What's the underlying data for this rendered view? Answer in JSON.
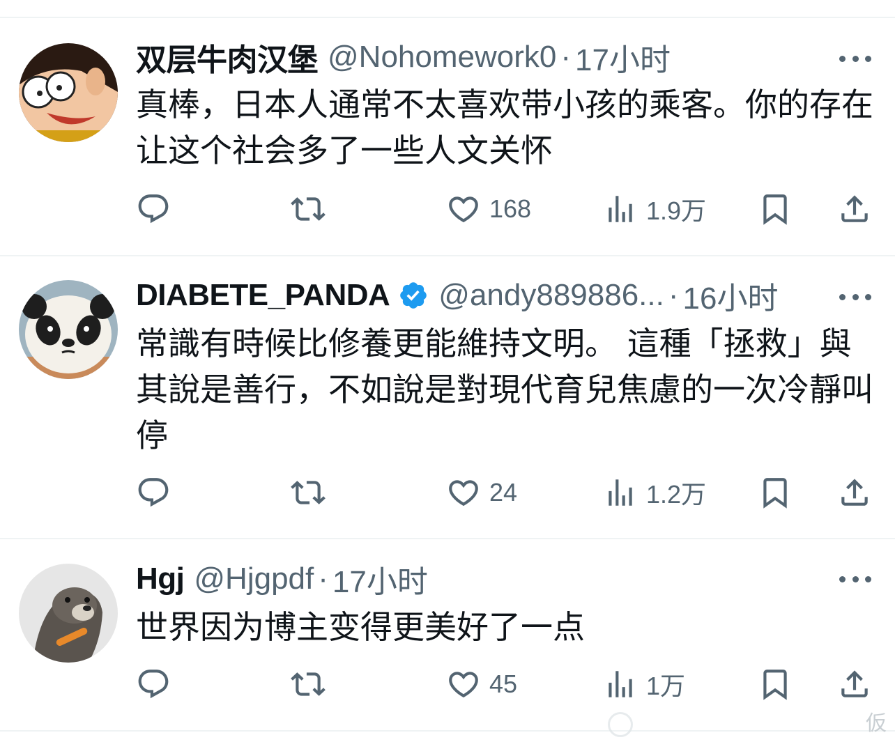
{
  "tweets": [
    {
      "name": "双层牛肉汉堡",
      "handle": "@Nohomework0",
      "separator": "·",
      "time": "17小时",
      "verified": false,
      "text": "真棒，日本人通常不太喜欢带小孩的乘客。你的存在让这个社会多了一些人文关怀",
      "likes": "168",
      "views": "1.9万",
      "avatar_icon": "cartoon-avatar"
    },
    {
      "name": "DIABETE_PANDA",
      "handle": "@andy889886...",
      "separator": "·",
      "time": "16小时",
      "verified": true,
      "text": "常識有時候比修養更能維持文明。 這種「拯救」與其說是善行，不如說是對現代育兒焦慮的一次冷靜叫停",
      "likes": "24",
      "views": "1.2万",
      "avatar_icon": "panda-avatar"
    },
    {
      "name": "Hgj",
      "handle": "@Hjgpdf",
      "separator": "·",
      "time": "17小时",
      "verified": false,
      "text": "世界因为博主变得更美好了一点",
      "likes": "45",
      "views": "1万",
      "avatar_icon": "otter-avatar"
    }
  ],
  "icons": {
    "reply": "reply-icon",
    "retweet": "retweet-icon",
    "like": "heart-icon",
    "views": "views-icon",
    "bookmark": "bookmark-icon",
    "share": "share-icon",
    "more": "more-icon"
  },
  "colors": {
    "text": "#0f1419",
    "secondary": "#536471",
    "verified": "#1d9bf0",
    "divider": "#eff3f4"
  },
  "watermark": "仮"
}
